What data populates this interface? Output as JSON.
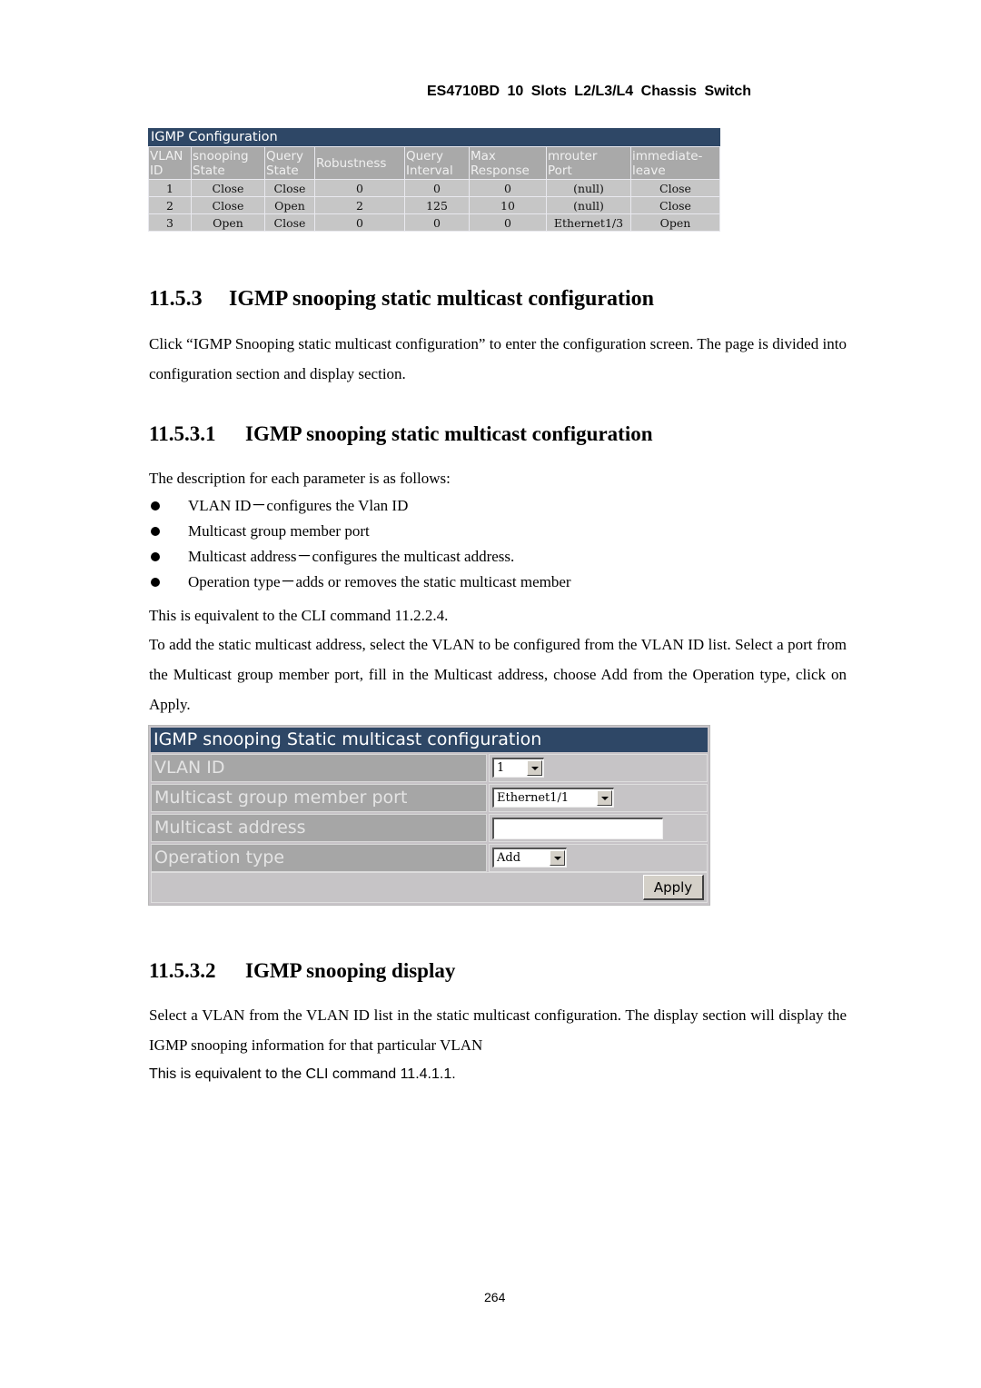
{
  "running_header": "ES4710BD 10 Slots L2/L3/L4 Chassis Switch",
  "igmp_config_table": {
    "title": "IGMP Configuration",
    "columns": [
      [
        "VLAN",
        "ID"
      ],
      [
        "snooping",
        "State"
      ],
      [
        "Query",
        "State"
      ],
      [
        "Robustness",
        ""
      ],
      [
        "Query",
        "Interval"
      ],
      [
        "Max",
        "Response"
      ],
      [
        "mrouter",
        "Port"
      ],
      [
        "immediate-",
        "leave"
      ]
    ],
    "rows": [
      [
        "1",
        "Close",
        "Close",
        "0",
        "0",
        "0",
        "(null)",
        "Close"
      ],
      [
        "2",
        "Close",
        "Open",
        "2",
        "125",
        "10",
        "(null)",
        "Close"
      ],
      [
        "3",
        "Open",
        "Close",
        "0",
        "0",
        "0",
        "Ethernet1/3",
        "Open"
      ]
    ]
  },
  "section_11_5_3": {
    "number": "11.5.3",
    "title": "IGMP snooping static multicast configuration",
    "paragraph": "Click “IGMP Snooping static multicast configuration” to enter the configuration screen. The page is divided into configuration section and display section."
  },
  "section_11_5_3_1": {
    "number": "11.5.3.1",
    "title": "IGMP snooping static multicast configuration",
    "intro": "The description for each parameter is as follows:",
    "bullets": [
      "VLAN ID－configures the Vlan ID",
      "Multicast group member port",
      "Multicast address－configures the multicast address.",
      "Operation type－adds or removes the static multicast member"
    ],
    "cli_note": "This is equivalent to the CLI command 11.2.2.4.",
    "instructions": "To add the static multicast address, select the VLAN to be configured from the VLAN ID list. Select a port from the Multicast group member port, fill in the Multicast address, choose Add from the Operation type, click on Apply."
  },
  "static_multicast_form": {
    "title": "IGMP snooping Static multicast configuration",
    "fields": {
      "vlan_id": {
        "label": "VLAN ID",
        "value": "1"
      },
      "member_port": {
        "label": "Multicast group member port",
        "value": "Ethernet1/1"
      },
      "multicast_address": {
        "label": "Multicast address",
        "value": ""
      },
      "operation_type": {
        "label": "Operation type",
        "value": "Add"
      }
    },
    "apply_label": "Apply"
  },
  "section_11_5_3_2": {
    "number": "11.5.3.2",
    "title": "IGMP snooping display",
    "paragraph": "Select a VLAN from the VLAN ID list in the static multicast configuration. The display section will display the IGMP snooping information for that particular VLAN",
    "cli_note": "This is equivalent to the CLI command 11.4.1.1."
  },
  "page_number": "264",
  "colors": {
    "panel_title_bg": "#2e4766",
    "header_cell_bg": "#a9a9a9",
    "data_cell_bg": "#c6c6c6"
  }
}
